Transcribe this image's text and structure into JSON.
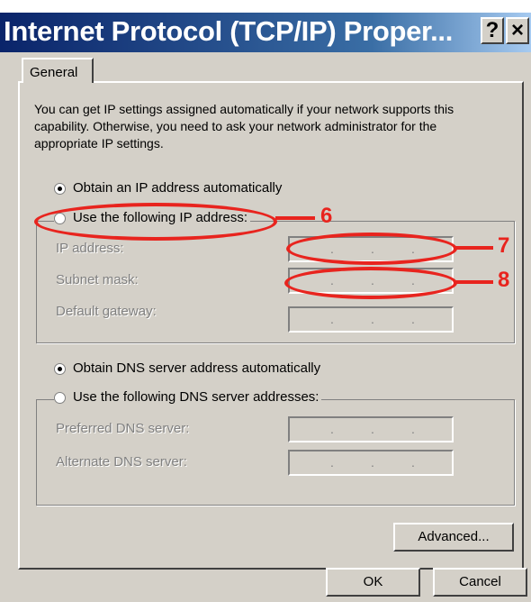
{
  "dialog": {
    "title": "Internet Protocol (TCP/IP) Proper...",
    "help_button": "?",
    "close_button": "×",
    "tab_general": "General",
    "description": "You can get IP settings assigned automatically if your network supports this capability. Otherwise, you need to ask your network administrator for the appropriate IP settings."
  },
  "ip": {
    "obtain_auto": "Obtain an IP address automatically",
    "obtain_auto_selected": true,
    "use_following": "Use the following IP address:",
    "use_following_selected": false,
    "fields": [
      {
        "label": "IP address:",
        "value": ""
      },
      {
        "label": "Subnet mask:",
        "value": ""
      },
      {
        "label": "Default gateway:",
        "value": ""
      }
    ]
  },
  "dns": {
    "obtain_auto": "Obtain DNS server address automatically",
    "obtain_auto_selected": true,
    "use_following": "Use the following DNS server addresses:",
    "use_following_selected": false,
    "fields": [
      {
        "label": "Preferred DNS server:",
        "value": ""
      },
      {
        "label": "Alternate DNS server:",
        "value": ""
      }
    ]
  },
  "buttons": {
    "advanced": "Advanced...",
    "ok": "OK",
    "cancel": "Cancel"
  },
  "annotations": [
    "6",
    "7",
    "8"
  ],
  "colors": {
    "title_gradient_start": "#0a246a",
    "title_gradient_end": "#a6caf0",
    "dialog_face": "#d4d0c8",
    "annotation": "#e8241e"
  }
}
